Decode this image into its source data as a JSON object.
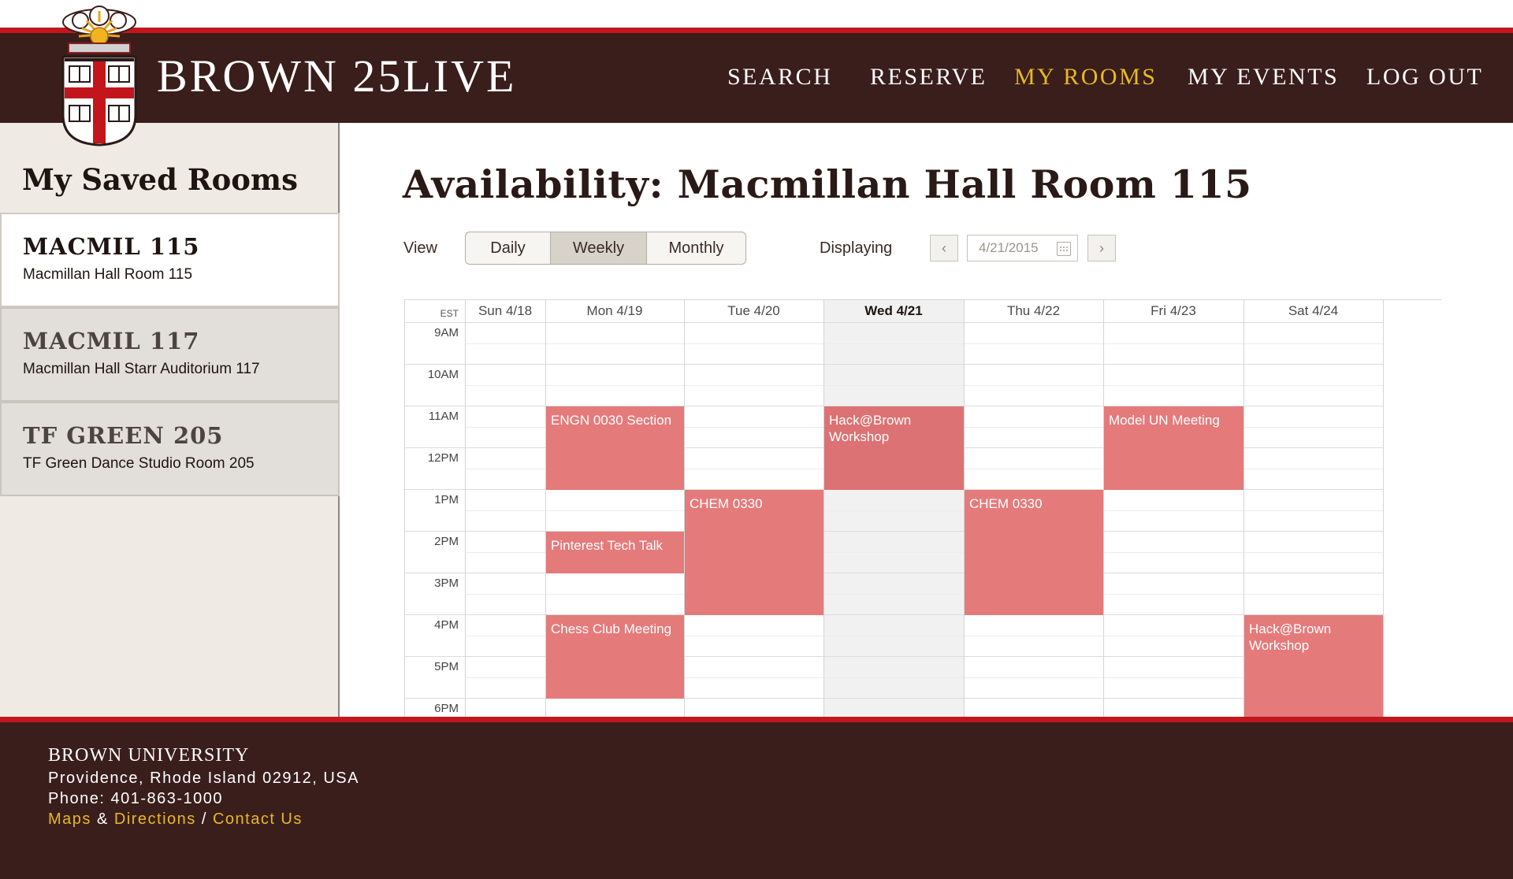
{
  "header": {
    "brand": "BROWN 25LIVE",
    "nav": [
      "SEARCH",
      "RESERVE",
      "MY ROOMS",
      "MY EVENTS",
      "LOG OUT"
    ],
    "active_nav": "MY ROOMS"
  },
  "sidebar": {
    "title": "My Saved Rooms",
    "rooms": [
      {
        "code": "MACMIL 115",
        "name": "Macmillan Hall Room 115",
        "selected": true
      },
      {
        "code": "MACMIL 117",
        "name": "Macmillan Hall Starr Auditorium 117",
        "selected": false
      },
      {
        "code": "TF GREEN 205",
        "name": "TF Green Dance Studio Room 205",
        "selected": false
      }
    ]
  },
  "main": {
    "title": "Availability: Macmillan Hall Room 115",
    "view_label": "View",
    "view_options": [
      "Daily",
      "Weekly",
      "Monthly"
    ],
    "active_view": "Weekly",
    "displaying_label": "Displaying",
    "date_value": "4/21/2015",
    "prev_label": "‹",
    "next_label": "›"
  },
  "calendar": {
    "timezone": "EST",
    "days": [
      "Sun 4/18",
      "Mon 4/19",
      "Tue 4/20",
      "Wed 4/21",
      "Thu 4/22",
      "Fri 4/23",
      "Sat 4/24"
    ],
    "today": "Wed 4/21",
    "times": [
      "9AM",
      "10AM",
      "11AM",
      "12PM",
      "1PM",
      "2PM",
      "3PM",
      "4PM",
      "5PM",
      "6PM"
    ],
    "events": [
      {
        "title": "ENGN 0030 Section",
        "day": "Mon 4/19",
        "start": "11:00",
        "end": "13:00"
      },
      {
        "title": "Pinterest Tech Talk",
        "day": "Mon 4/19",
        "start": "14:00",
        "end": "15:00"
      },
      {
        "title": "Chess Club Meeting",
        "day": "Mon 4/19",
        "start": "16:00",
        "end": "18:00"
      },
      {
        "title": "CHEM 0330",
        "day": "Tue 4/20",
        "start": "13:00",
        "end": "16:00"
      },
      {
        "title": "Hack@Brown Workshop",
        "day": "Wed 4/21",
        "start": "11:00",
        "end": "13:00"
      },
      {
        "title": "CHEM 0330",
        "day": "Thu 4/22",
        "start": "13:00",
        "end": "16:00"
      },
      {
        "title": "Model UN Meeting",
        "day": "Fri 4/23",
        "start": "11:00",
        "end": "13:00"
      },
      {
        "title": "Hack@Brown Workshop",
        "day": "Sat 4/24",
        "start": "16:00",
        "end": "19:00"
      }
    ],
    "colors": {
      "event": "#e57a7b",
      "today_column": "#f1f1f1"
    }
  },
  "footer": {
    "org": "BROWN UNIVERSITY",
    "address": "Providence, Rhode Island 02912, USA",
    "phone": "Phone: 401-863-1000",
    "links": [
      "Maps",
      "Directions",
      "Contact Us"
    ],
    "sep1": " & ",
    "sep2": " / "
  },
  "colors": {
    "brown": "#3a1e1b",
    "red": "#c3161c",
    "gold": "#e8b923"
  }
}
